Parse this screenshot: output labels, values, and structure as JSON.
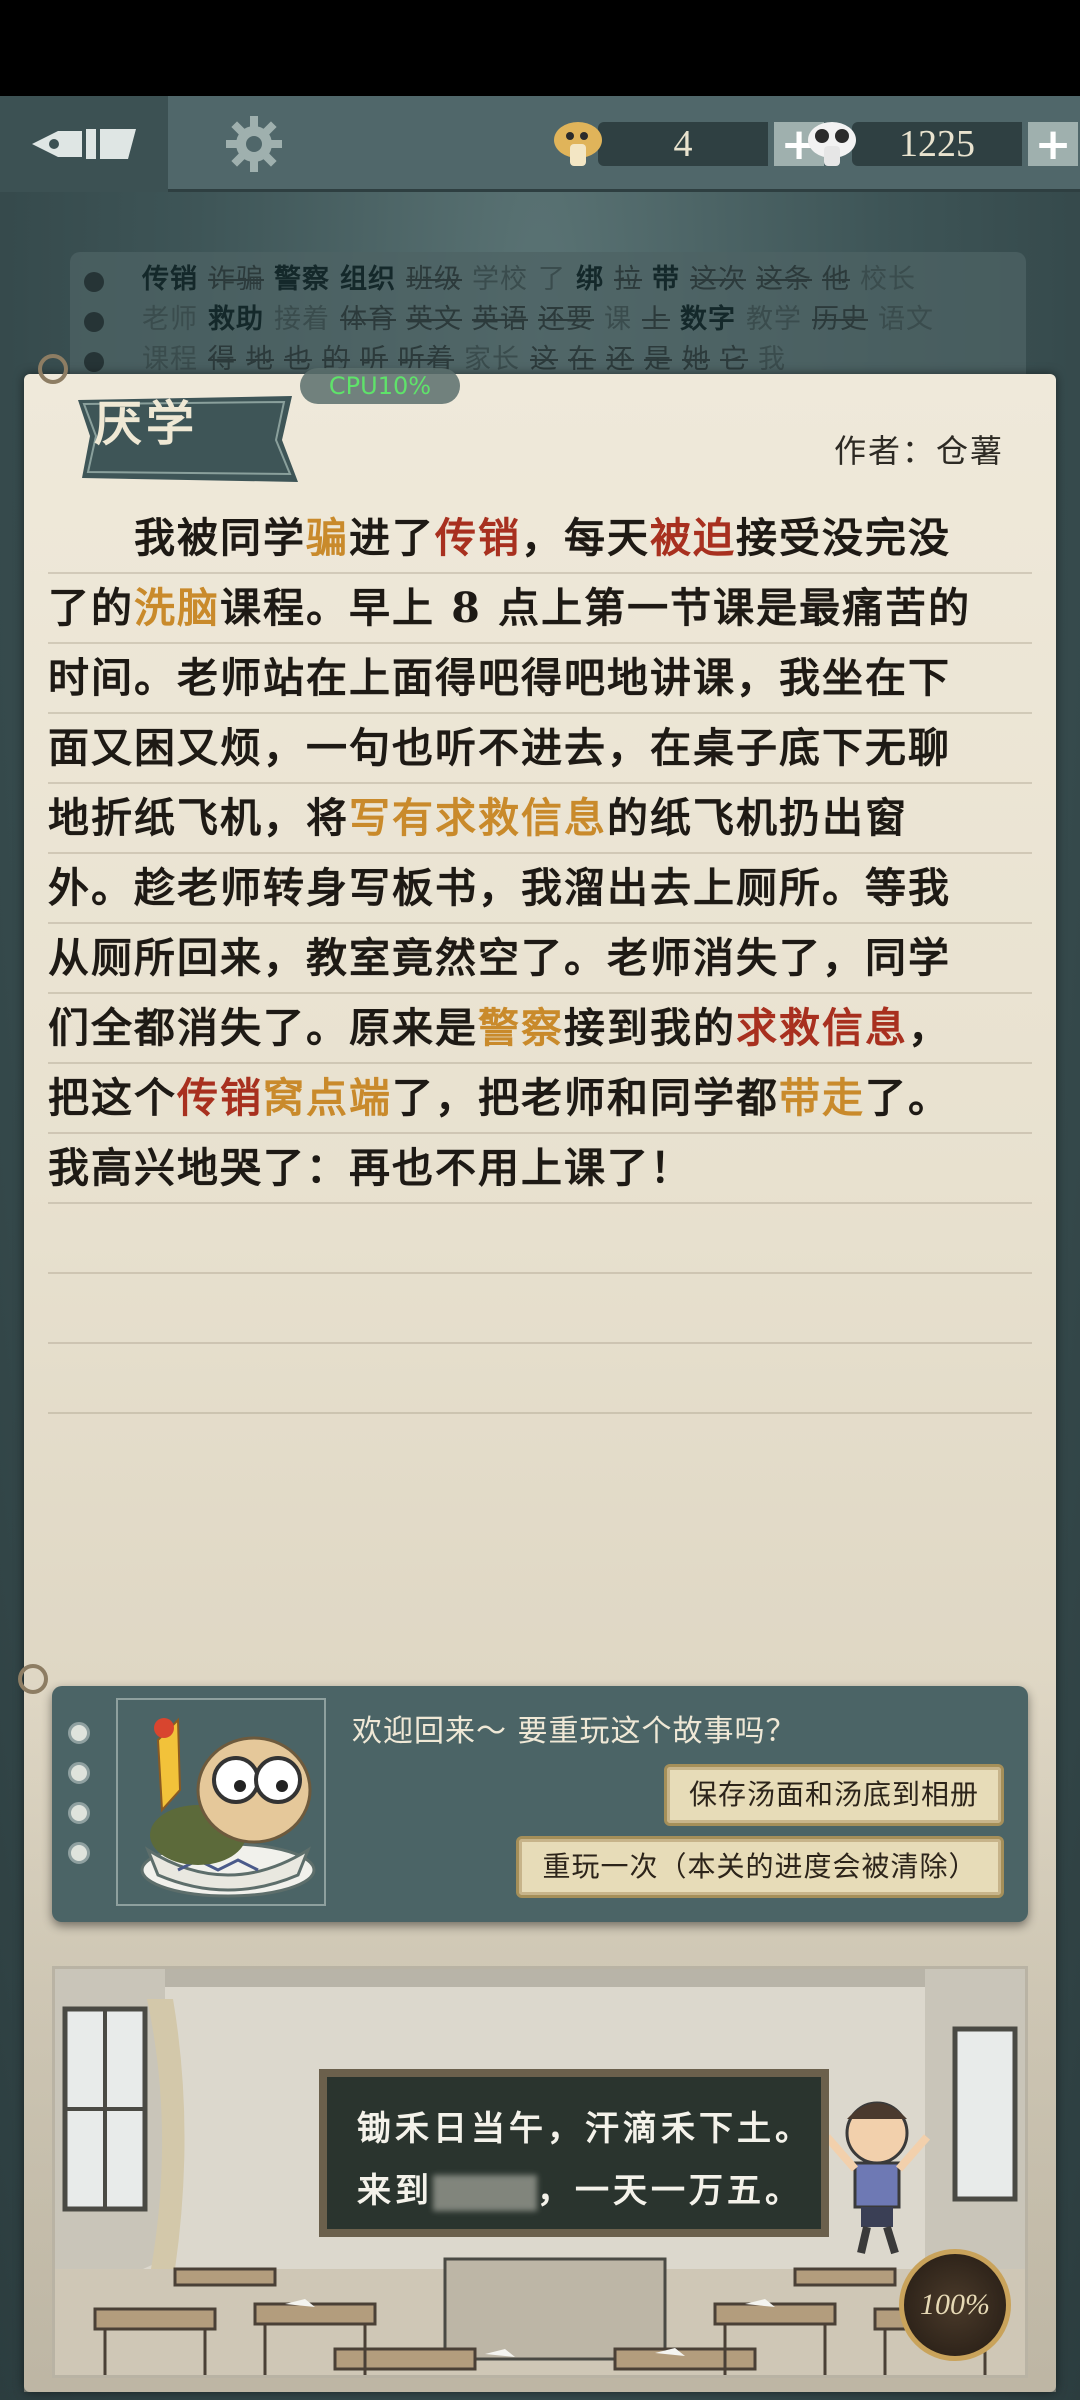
{
  "topbar": {
    "currency_coin": {
      "value": "4",
      "plus": "+"
    },
    "currency_panda": {
      "value": "1225",
      "plus": "+"
    }
  },
  "word_bank": {
    "rows": [
      [
        {
          "t": "传销",
          "style": "bold"
        },
        {
          "t": "诈骗",
          "style": "struck"
        },
        {
          "t": "警察",
          "style": "bold"
        },
        {
          "t": "组织",
          "style": "bold"
        },
        {
          "t": "班级",
          "style": "struck"
        },
        {
          "t": "学校",
          "style": "dim"
        },
        {
          "t": "了",
          "style": "dim"
        },
        {
          "t": "绑",
          "style": "bold"
        },
        {
          "t": "拉",
          "style": "struck"
        },
        {
          "t": "带",
          "style": "bold"
        },
        {
          "t": "这次",
          "style": "struck"
        },
        {
          "t": "这条",
          "style": "struck"
        },
        {
          "t": "他",
          "style": "struck"
        },
        {
          "t": "校长",
          "style": "dim"
        }
      ],
      [
        {
          "t": "老师",
          "style": "dim"
        },
        {
          "t": "救助",
          "style": "bold"
        },
        {
          "t": "接着",
          "style": "dim"
        },
        {
          "t": "体育",
          "style": "struck"
        },
        {
          "t": "英文",
          "style": "struck"
        },
        {
          "t": "英语",
          "style": "struck"
        },
        {
          "t": "还要",
          "style": "struck"
        },
        {
          "t": "课",
          "style": "dim"
        },
        {
          "t": "上",
          "style": "struck"
        },
        {
          "t": "数字",
          "style": "bold"
        },
        {
          "t": "教学",
          "style": "dim"
        },
        {
          "t": "历史",
          "style": "struck"
        },
        {
          "t": "语文",
          "style": "dim"
        }
      ],
      [
        {
          "t": "课程",
          "style": "dim"
        },
        {
          "t": "得",
          "style": "struck"
        },
        {
          "t": "地",
          "style": "struck"
        },
        {
          "t": "也",
          "style": "struck"
        },
        {
          "t": "的",
          "style": "struck"
        },
        {
          "t": "听",
          "style": "struck"
        },
        {
          "t": "听着",
          "style": "struck"
        },
        {
          "t": "家长",
          "style": "dim"
        },
        {
          "t": "这",
          "style": "struck"
        },
        {
          "t": "在",
          "style": "struck"
        },
        {
          "t": "还",
          "style": "struck"
        },
        {
          "t": "是",
          "style": "struck"
        },
        {
          "t": "她",
          "style": "struck"
        },
        {
          "t": "它",
          "style": "struck"
        },
        {
          "t": "我",
          "style": "dim"
        }
      ]
    ]
  },
  "cpu_indicator": "CPU10%",
  "story": {
    "title": "厌学",
    "author": "作者：仓薯",
    "lines": [
      [
        {
          "t": "　　我被同学",
          "c": ""
        },
        {
          "t": "骗",
          "c": "orange"
        },
        {
          "t": "进了",
          "c": ""
        },
        {
          "t": "传销",
          "c": "red"
        },
        {
          "t": "，每天",
          "c": ""
        },
        {
          "t": "被迫",
          "c": "red"
        },
        {
          "t": "接受没完没",
          "c": ""
        }
      ],
      [
        {
          "t": "了的",
          "c": ""
        },
        {
          "t": "洗脑",
          "c": "orange"
        },
        {
          "t": "课程。早上 8 点上第一节课是最痛苦的",
          "c": ""
        }
      ],
      [
        {
          "t": "时间。老师站在上面得吧得吧地讲课，我坐在下",
          "c": ""
        }
      ],
      [
        {
          "t": "面又困又烦，一句也听不进去，在桌子底下无聊",
          "c": ""
        }
      ],
      [
        {
          "t": "地折纸飞机，将",
          "c": ""
        },
        {
          "t": "写有求救信息",
          "c": "orange"
        },
        {
          "t": "的纸飞机扔出窗",
          "c": ""
        }
      ],
      [
        {
          "t": "外。趁老师转身写板书，我溜出去上厕所。等我",
          "c": ""
        }
      ],
      [
        {
          "t": "从厕所回来，教室竟然空了。老师消失了，同学",
          "c": ""
        }
      ],
      [
        {
          "t": "们全都消失了。原来是",
          "c": ""
        },
        {
          "t": "警察",
          "c": "orange"
        },
        {
          "t": "接到我的",
          "c": ""
        },
        {
          "t": "求救信息",
          "c": "red"
        },
        {
          "t": "，",
          "c": ""
        }
      ],
      [
        {
          "t": "把这个",
          "c": ""
        },
        {
          "t": "传销",
          "c": "red"
        },
        {
          "t": "窝点端",
          "c": "orange"
        },
        {
          "t": "了，把老师和同学都",
          "c": ""
        },
        {
          "t": "带走",
          "c": "orange"
        },
        {
          "t": "了。",
          "c": ""
        }
      ],
      [
        {
          "t": "我高兴地哭了：再也不用上课了！",
          "c": ""
        }
      ],
      [],
      [],
      []
    ]
  },
  "dialog": {
    "message": "欢迎回来～ 要重玩这个故事吗？",
    "save_button": "保存汤面和汤底到相册",
    "replay_button": "重玩一次（本关的进度会被清除）"
  },
  "scene": {
    "board_line1": "锄禾日当午，汗滴禾下土。",
    "board_line2_prefix": "来到",
    "board_line2_suffix": "，一天一万五。",
    "progress": "100%"
  },
  "colors": {
    "highlight_red": "#a8301f",
    "highlight_orange": "#c98a2b",
    "panel_teal": "#4b6466",
    "paper": "#efe9da"
  }
}
